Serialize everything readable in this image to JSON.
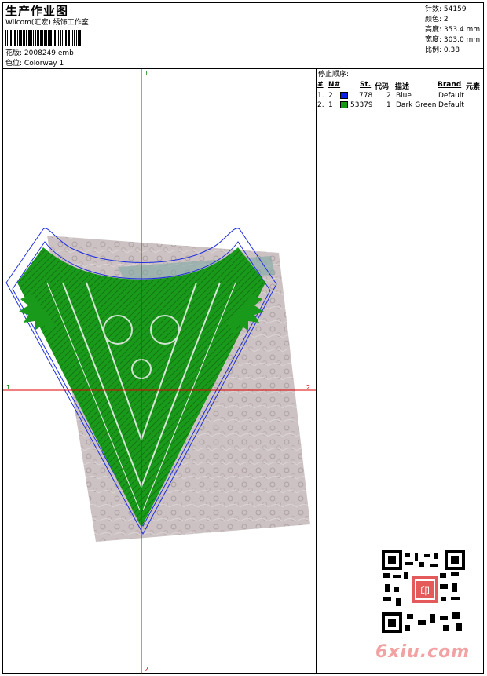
{
  "header": {
    "title": "生产作业图",
    "company": "Wilcom(汇宏) 绣饰工作室",
    "design_file_label": "花版:",
    "design_file": "2008249.emb",
    "colorway_label": "色位:",
    "colorway": "Colorway 1"
  },
  "stats": [
    {
      "label": "针数:",
      "value": "54159"
    },
    {
      "label": "颜色:",
      "value": "2"
    },
    {
      "label": "高度:",
      "value": "353.4 mm"
    },
    {
      "label": "宽度:",
      "value": "303.0 mm"
    },
    {
      "label": "比例:",
      "value": "0.38"
    }
  ],
  "stop_sequence": {
    "title": "停止顺序:",
    "columns": [
      "#",
      "N#",
      "St.",
      "代码",
      "描述",
      "Brand",
      "元素"
    ],
    "rows": [
      {
        "index": "1.",
        "n": "2",
        "color": "#0a1ee6",
        "stitches": "778",
        "code": "2",
        "description": "Blue",
        "brand": "Default"
      },
      {
        "index": "2.",
        "n": "1",
        "color": "#139a13",
        "stitches": "53379",
        "code": "1",
        "description": "Dark Green",
        "brand": "Default"
      }
    ]
  },
  "axes": {
    "top": "1",
    "bottom": "2",
    "left": "1",
    "right": "2"
  },
  "colors": {
    "outline": "#1f2fe0",
    "fill": "#1a9a1a",
    "crosshair": "#e00000",
    "watermark": "#f2a2a2"
  },
  "watermark": "6xiu.com",
  "qr_stamp": "印"
}
